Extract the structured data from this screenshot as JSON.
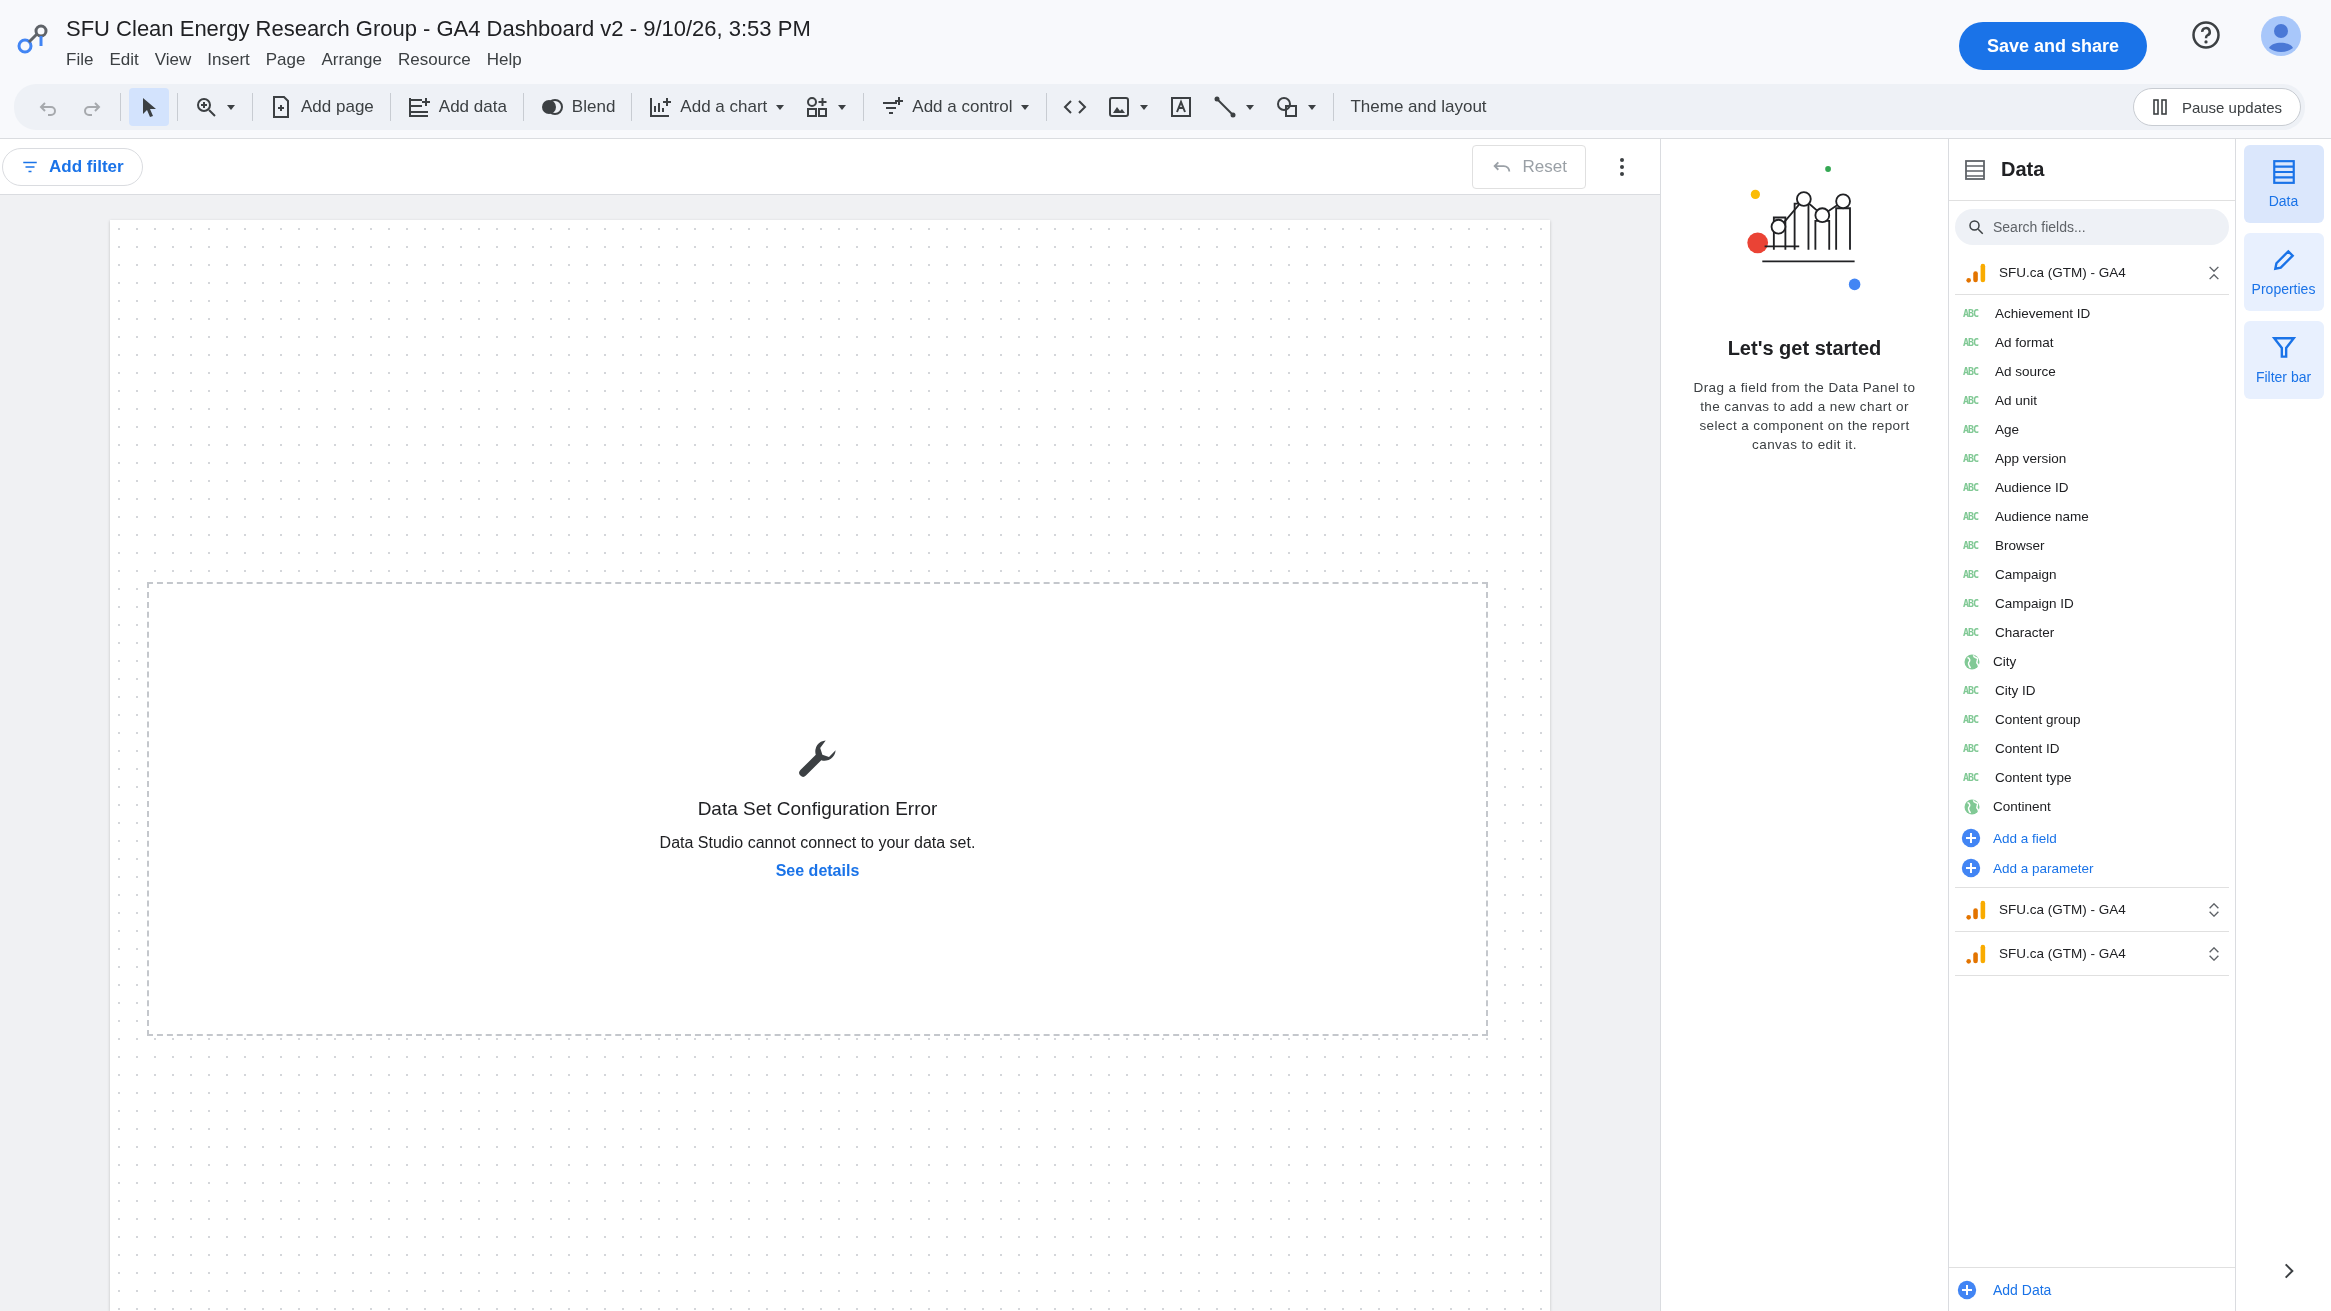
{
  "app": {
    "title": "SFU Clean Energy Research Group - GA4 Dashboard v2 - 9/10/26, 3:53 PM",
    "menus": [
      "File",
      "Edit",
      "View",
      "Insert",
      "Page",
      "Arrange",
      "Resource",
      "Help"
    ],
    "save_button": "Save and share"
  },
  "toolbar": {
    "items": [
      {
        "kind": "undo",
        "disabled": true,
        "selected": false,
        "menu": false
      },
      {
        "kind": "redo",
        "disabled": true,
        "selected": false,
        "menu": false
      },
      {
        "kind": "divider"
      },
      {
        "kind": "pointer",
        "disabled": false,
        "selected": true,
        "menu": false
      },
      {
        "kind": "divider"
      },
      {
        "kind": "zoom",
        "disabled": false,
        "selected": false,
        "menu": true
      },
      {
        "kind": "divider"
      },
      {
        "kind": "page",
        "label": "Add page",
        "disabled": false,
        "selected": false,
        "menu": false
      },
      {
        "kind": "divider"
      },
      {
        "kind": "data",
        "label": "Add data",
        "disabled": false,
        "selected": false,
        "menu": false
      },
      {
        "kind": "divider"
      },
      {
        "kind": "blend",
        "label": "Blend",
        "disabled": false,
        "selected": false,
        "menu": false
      },
      {
        "kind": "divider"
      },
      {
        "kind": "chart",
        "label": "Add a chart",
        "disabled": false,
        "selected": false,
        "menu": true
      },
      {
        "kind": "components",
        "disabled": false,
        "selected": false,
        "menu": true
      },
      {
        "kind": "divider"
      },
      {
        "kind": "control",
        "label": "Add a control",
        "disabled": false,
        "selected": false,
        "menu": true
      },
      {
        "kind": "divider"
      },
      {
        "kind": "code",
        "disabled": false,
        "selected": false,
        "menu": false
      },
      {
        "kind": "image",
        "disabled": false,
        "selected": false,
        "menu": true
      },
      {
        "kind": "textbox",
        "disabled": false,
        "selected": false,
        "menu": false
      },
      {
        "kind": "line",
        "disabled": false,
        "selected": false,
        "menu": true
      },
      {
        "kind": "shape",
        "disabled": false,
        "selected": false,
        "menu": true
      },
      {
        "kind": "divider"
      },
      {
        "kind": "theme",
        "label": "Theme and layout",
        "disabled": false,
        "selected": false,
        "menu": false
      }
    ],
    "pause_button": "Pause updates"
  },
  "filter_bar": {
    "add_filter": "Add filter",
    "reset": {
      "label": "Reset",
      "disabled": true
    }
  },
  "canvas": {
    "error": {
      "title": "Data Set Configuration Error",
      "message": "Data Studio cannot connect to your data set.",
      "link": "See details"
    }
  },
  "welcome": {
    "title": "Let's get started",
    "text": "Drag a field from the Data Panel to the canvas to add a new chart or select a component on the report canvas to edit it."
  },
  "data_panel": {
    "title": "Data",
    "search": {
      "placeholder": "Search fields..."
    },
    "sources": [
      {
        "name": "SFU.ca (GTM) - GA4",
        "expanded": true,
        "fields": [
          {
            "name": "Achievement ID",
            "kind": "text",
            "badge": "ABC"
          },
          {
            "name": "Ad format",
            "kind": "text",
            "badge": "ABC"
          },
          {
            "name": "Ad source",
            "kind": "text",
            "badge": "ABC"
          },
          {
            "name": "Ad unit",
            "kind": "text",
            "badge": "ABC"
          },
          {
            "name": "Age",
            "kind": "text",
            "badge": "ABC"
          },
          {
            "name": "App version",
            "kind": "text",
            "badge": "ABC"
          },
          {
            "name": "Audience ID",
            "kind": "text",
            "badge": "ABC"
          },
          {
            "name": "Audience name",
            "kind": "text",
            "badge": "ABC"
          },
          {
            "name": "Browser",
            "kind": "text",
            "badge": "ABC"
          },
          {
            "name": "Campaign",
            "kind": "text",
            "badge": "ABC"
          },
          {
            "name": "Campaign ID",
            "kind": "text",
            "badge": "ABC"
          },
          {
            "name": "Character",
            "kind": "text",
            "badge": "ABC"
          },
          {
            "name": "City",
            "kind": "geo"
          },
          {
            "name": "City ID",
            "kind": "text",
            "badge": "ABC"
          },
          {
            "name": "Content group",
            "kind": "text",
            "badge": "ABC"
          },
          {
            "name": "Content ID",
            "kind": "text",
            "badge": "ABC"
          },
          {
            "name": "Content type",
            "kind": "text",
            "badge": "ABC"
          },
          {
            "name": "Continent",
            "kind": "geo"
          }
        ],
        "actions": [
          "Add a field",
          "Add a parameter"
        ]
      },
      {
        "name": "SFU.ca (GTM) - GA4",
        "expanded": false
      },
      {
        "name": "SFU.ca (GTM) - GA4",
        "expanded": false
      }
    ],
    "add_data": "Add Data"
  },
  "rail": {
    "tabs": [
      {
        "kind": "data",
        "label": "Data",
        "selected": true
      },
      {
        "kind": "properties",
        "label": "Properties",
        "selected": false
      },
      {
        "kind": "filter",
        "label": "Filter bar",
        "selected": false
      }
    ]
  }
}
